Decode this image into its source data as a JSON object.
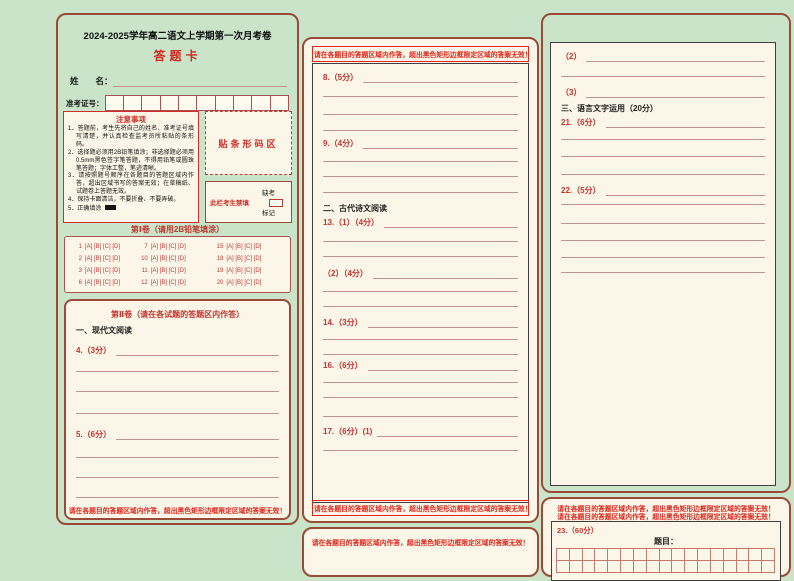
{
  "colors": {
    "page_bg": "#c9e4c8",
    "box_border": "#9a4a38",
    "panel_bg": "#fbf6e7",
    "accent_red": "#c23530",
    "warning_red": "#e0251c",
    "line": "#c09490"
  },
  "header": {
    "title": "2024-2025学年高二语文上学期第一次月考卷",
    "card": "答题卡",
    "name_label": "姓　　名：",
    "exam_label": "准考证号：",
    "exam_cells": 10
  },
  "notice": {
    "title": "注意事项",
    "items": [
      "1．答题前，考生先将自己的姓名、准考证号填写清楚，并认真检查监考员所粘贴的条形码。",
      "2．选择题必须用2B铅笔填涂；非选择题必须用0.5mm黑色签字笔答题，不得用铅笔或圆珠笔答题；字体工整，笔迹清晰。",
      "3．请按照题号顺序在各题目的答题区域内作答，超出区域书写的答案无效；在草稿纸、试题卷上答题无效。",
      "4．保持卡面清洁，不要折叠、不要弄破。",
      "5．正确填涂"
    ]
  },
  "barcode": {
    "label": "贴条形码区"
  },
  "absent": {
    "note": "此栏考生禁填",
    "line1": "缺考",
    "line2": "标记"
  },
  "part1": {
    "title": "第Ⅰ卷（请用2B铅笔填涂）",
    "options": "[A] [B] [C] [D]",
    "columns": [
      [
        "1",
        "2",
        "3",
        "6"
      ],
      [
        "7",
        "10",
        "11",
        "12"
      ],
      [
        "15",
        "18",
        "19",
        "20"
      ]
    ]
  },
  "part2": {
    "title": "第Ⅱ卷（请在各试题的答题区内作答）",
    "section": "一、现代文阅读",
    "q4": "4.（3分）",
    "q5": "5.（6分）",
    "warning": "请在各题目的答题区域内作答，超出黑色矩形边框限定区域的答案无效！"
  },
  "middle": {
    "warning_top": "请在各题目的答题区域内作答，超出黑色矩形边框限定区域的答案无效！",
    "q8": "8.（5分）",
    "q9": "9.（4分）",
    "section": "二、古代诗文阅读",
    "q13_1": "13.（1）（4分）",
    "q13_2": "（2）（4分）",
    "q14": "14.（3分）",
    "q16": "16.（6分）",
    "q17": "17.（6分）(1)",
    "warning_bottom": "请在各题目的答题区域内作答，超出黑色矩形边框限定区域的答案无效！"
  },
  "right": {
    "q17_2": "（2）",
    "q17_3": "（3）",
    "section": "三、语言文字运用（20分）",
    "q21": "21.（6分）",
    "q22": "22.（5分）"
  },
  "essay": {
    "warning1": "请在各题目的答题区域内作答，超出黑色矩形边框限定区域的答案无效！",
    "warning2": "请在各题目的答题区域内作答，超出黑色矩形边框限定区域的答案无效！",
    "q23": "23.（60分）",
    "topic": "题目：",
    "grid_cols": 17,
    "grid_rows": 2
  },
  "bottom_middle": {
    "warning": "请在各题目的答题区域内作答，超出黑色矩形边框限定区域的答案无效！"
  }
}
